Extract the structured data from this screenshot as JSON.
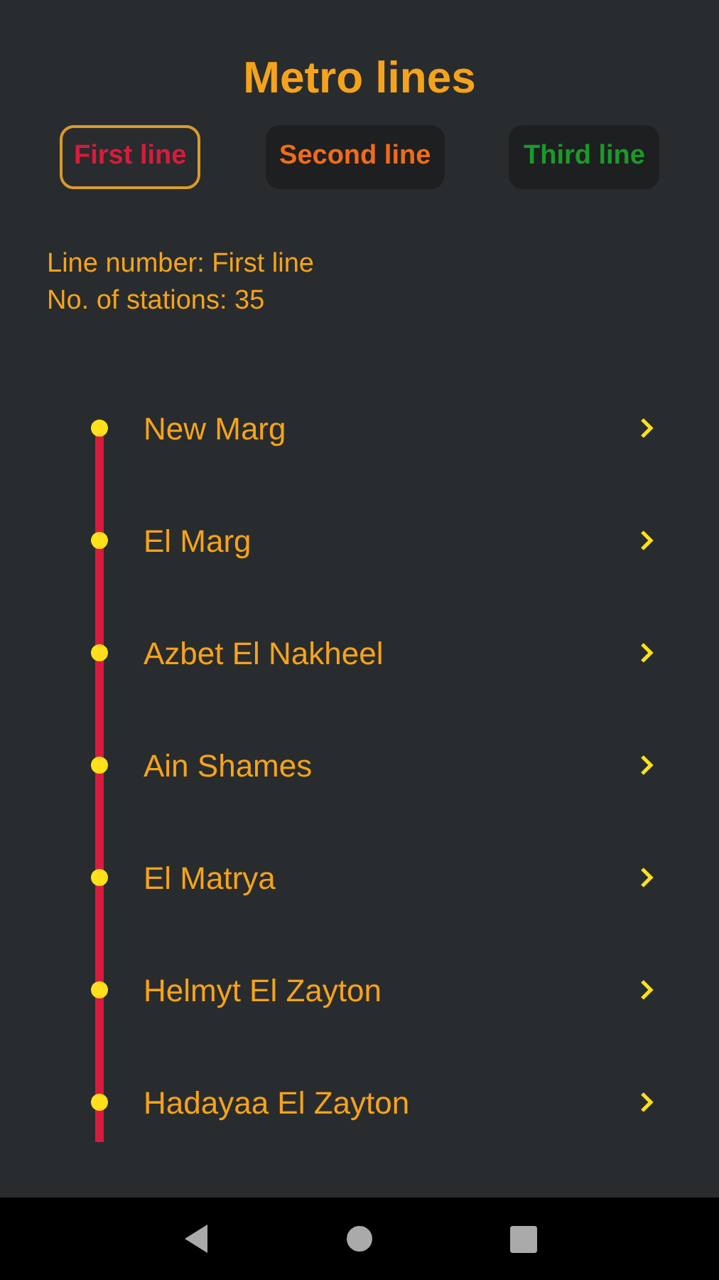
{
  "title": "Metro lines",
  "tabs": [
    {
      "label": "First line",
      "selected": true,
      "color": "#d81b3c"
    },
    {
      "label": "Second line",
      "selected": false,
      "color": "#f06c1a"
    },
    {
      "label": "Third line",
      "selected": false,
      "color": "#1a9a2a"
    }
  ],
  "info": [
    "Line number: First line",
    "No. of stations: 35"
  ],
  "stations": [
    {
      "name": "New Marg"
    },
    {
      "name": "El Marg"
    },
    {
      "name": "Azbet El Nakheel"
    },
    {
      "name": "Ain Shames"
    },
    {
      "name": "El Matrya"
    },
    {
      "name": "Helmyt El Zayton"
    },
    {
      "name": "Hadayaa El Zayton"
    }
  ]
}
